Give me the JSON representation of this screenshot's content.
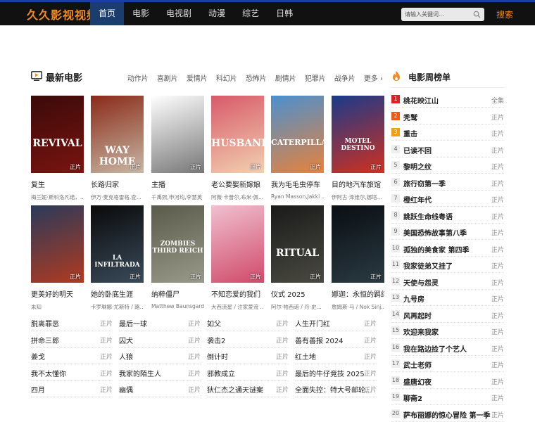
{
  "site": {
    "logo": "久久影视视频"
  },
  "nav": [
    {
      "label": "首页",
      "active": true
    },
    {
      "label": "电影"
    },
    {
      "label": "电视剧"
    },
    {
      "label": "动漫"
    },
    {
      "label": "综艺"
    },
    {
      "label": "日韩"
    }
  ],
  "search": {
    "placeholder": "请输入关键词...",
    "button": "搜索"
  },
  "latest": {
    "title": "最新电影",
    "genres": [
      "动作片",
      "喜剧片",
      "爱情片",
      "科幻片",
      "恐怖片",
      "剧情片",
      "犯罪片",
      "战争片"
    ],
    "more": "更多 ›"
  },
  "cards": [
    {
      "title": "复生",
      "sub": "梅兰妮·斯科洛凡诺，...",
      "tag": "正片",
      "poster_text": "REVIVAL",
      "c1": "#3a0a0a",
      "c2": "#7a1410"
    },
    {
      "title": "长路归家",
      "sub": "伊万·麦克格雷格,查...",
      "tag": "正片",
      "poster_text": "WAY HOME",
      "c1": "#8a2a18",
      "c2": "#c7b7a4"
    },
    {
      "title": "主播",
      "sub": "千禹熙,申河均,李慧英",
      "tag": "正片",
      "poster_text": "",
      "c1": "#ffffff",
      "c2": "#777777"
    },
    {
      "title": "老公要娶新嫁娘",
      "sub": "阿薇·卡普尔,布米·佩...",
      "tag": "正片",
      "poster_text": "HUSBAND",
      "c1": "#d85a6a",
      "c2": "#f2d0b0"
    },
    {
      "title": "我为毛毛虫停车",
      "sub": "Ryan Masson,Jakki ...",
      "tag": "正片",
      "poster_text": "CATERPILLARS",
      "c1": "#4a90d0",
      "c2": "#e8823a"
    },
    {
      "title": "目的地汽车旅馆",
      "sub": "伊阿古·泽维尔,娜塔...",
      "tag": "正片",
      "poster_text": "MOTEL DESTINO",
      "c1": "#1a3a8a",
      "c2": "#d03020"
    },
    {
      "title": "更美好的明天",
      "sub": "未知",
      "tag": "正片",
      "poster_text": "",
      "c1": "#2a3a5a",
      "c2": "#b03a20"
    },
    {
      "title": "她的卧底生涯",
      "sub": "卡罗琳娜·尤斯特 / 路...",
      "tag": "正片",
      "poster_text": "LA INFILTRADA",
      "c1": "#0a0a0a",
      "c2": "#3a4a5a"
    },
    {
      "title": "纳粹僵尸",
      "sub": "Matthew Baunsgard ...",
      "tag": "正片",
      "poster_text": "ZOMBIES THIRD REICH",
      "c1": "#5a5a4a",
      "c2": "#9a9a8a"
    },
    {
      "title": "不知恋爱的我们",
      "sub": "大西流星 / 注家爱流 ...",
      "tag": "正片",
      "poster_text": "",
      "c1": "#f0c0d0",
      "c2": "#d04a6a"
    },
    {
      "title": "仪式 2025",
      "sub": "阿尔·帕西诺 / 丹·史...",
      "tag": "正片",
      "poster_text": "RITUAL",
      "c1": "#1a1a1a",
      "c2": "#4a4a42"
    },
    {
      "title": "娜迦：永恒的羁绊",
      "sub": "詹姆斯·马 / Nok Sinj...",
      "tag": "正片",
      "poster_text": "",
      "c1": "#0a0e12",
      "c2": "#2a3a42"
    }
  ],
  "text_list": [
    {
      "name": "脱离罪恶",
      "tag": "正片"
    },
    {
      "name": "最后一球",
      "tag": "正片"
    },
    {
      "name": "如父",
      "tag": "正片"
    },
    {
      "name": "人生开门红",
      "tag": "正片"
    },
    {
      "name": "拼命三郎",
      "tag": "正片"
    },
    {
      "name": "囚犬",
      "tag": "正片"
    },
    {
      "name": "袭击2",
      "tag": "正片"
    },
    {
      "name": "善有善报 2024",
      "tag": "正片"
    },
    {
      "name": "姜戈",
      "tag": "正片"
    },
    {
      "name": "人狼",
      "tag": "正片"
    },
    {
      "name": "倒计时",
      "tag": "正片"
    },
    {
      "name": "红土地",
      "tag": "正片"
    },
    {
      "name": "我不太懂你",
      "tag": "正片"
    },
    {
      "name": "我家的陌生人",
      "tag": "正片"
    },
    {
      "name": "邪教成立",
      "tag": "正片"
    },
    {
      "name": "最后的牛仔竞技 2025",
      "tag": "正片"
    },
    {
      "name": "四月",
      "tag": "正片"
    },
    {
      "name": "幽偶",
      "tag": "正片"
    },
    {
      "name": "狄仁杰之通天谜案",
      "tag": "正片"
    },
    {
      "name": "全面失控：特大号邮轮...",
      "tag": "正片"
    }
  ],
  "rank": {
    "title": "电影周榜单",
    "items": [
      {
        "num": "1",
        "name": "桃花映江山",
        "tag": "全集"
      },
      {
        "num": "2",
        "name": "秃鹫",
        "tag": "正片"
      },
      {
        "num": "3",
        "name": "重击",
        "tag": "正片"
      },
      {
        "num": "4",
        "name": "已读不回",
        "tag": "正片"
      },
      {
        "num": "5",
        "name": "黎明之纹",
        "tag": "正片"
      },
      {
        "num": "6",
        "name": "旅行窃第一季",
        "tag": "正片"
      },
      {
        "num": "7",
        "name": "橙红年代",
        "tag": "正片"
      },
      {
        "num": "8",
        "name": "跳跃生命线粤语",
        "tag": "正片"
      },
      {
        "num": "9",
        "name": "美国恐怖故事第八季",
        "tag": "正片"
      },
      {
        "num": "10",
        "name": "孤独的美食家 第四季",
        "tag": "正片"
      },
      {
        "num": "11",
        "name": "我家徒弟又挂了",
        "tag": "正片"
      },
      {
        "num": "12",
        "name": "天使与怨灵",
        "tag": "正片"
      },
      {
        "num": "13",
        "name": "九号房",
        "tag": "正片"
      },
      {
        "num": "14",
        "name": "风再起时",
        "tag": "正片"
      },
      {
        "num": "15",
        "name": "欢迎来我家",
        "tag": "正片"
      },
      {
        "num": "16",
        "name": "我在路边捡了个艺人",
        "tag": "正片"
      },
      {
        "num": "17",
        "name": "武士老师",
        "tag": "正片"
      },
      {
        "num": "18",
        "name": "盛唐幻夜",
        "tag": "正片"
      },
      {
        "num": "19",
        "name": "聊斋2",
        "tag": "正片"
      },
      {
        "num": "20",
        "name": "萨布丽娜的惊心冒险 第一季",
        "tag": "正片"
      }
    ]
  }
}
